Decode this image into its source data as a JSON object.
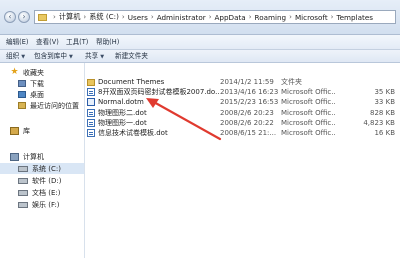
{
  "address": {
    "crumbs": [
      "计算机",
      "系统 (C:)",
      "Users",
      "Administrator",
      "AppData",
      "Roaming",
      "Microsoft",
      "Templates"
    ],
    "separator": "›"
  },
  "menu": {
    "items": [
      "组织",
      "包含到库中",
      "共享",
      "新建文件夹"
    ]
  },
  "toolbar": {
    "items": [
      "编辑(E)",
      "查看(V)",
      "工具(T)",
      "帮助(H)"
    ]
  },
  "sidebar": {
    "favorites_label": "收藏夹",
    "favorites": [
      "下载",
      "桌面",
      "最近访问的位置"
    ],
    "library_label": "库",
    "computer_label": "计算机",
    "drives": [
      "系统 (C:)",
      "软件 (D:)",
      "文档 (E:)",
      "娱乐 (F:)"
    ]
  },
  "files": [
    {
      "name": "Document Themes",
      "date": "2014/1/2 11:59",
      "type": "文件夹",
      "size": "",
      "icon": "folder-icon"
    },
    {
      "name": "8开双面双页码密封试卷模板2007.do...",
      "date": "2013/4/16 16:23",
      "type": "Microsoft Offic...",
      "size": "35 KB",
      "icon": "word-doc-icon"
    },
    {
      "name": "Normal.dotm",
      "date": "2015/2/23 16:53",
      "type": "Microsoft Offic...",
      "size": "33 KB",
      "icon": "word-template-icon"
    },
    {
      "name": "物理图形二.dot",
      "date": "2008/2/6 20:23",
      "type": "Microsoft Offic...",
      "size": "828 KB",
      "icon": "word-doc-icon"
    },
    {
      "name": "物理图形一.dot",
      "date": "2008/2/6 20:22",
      "type": "Microsoft Offic...",
      "size": "4,823 KB",
      "icon": "word-doc-icon"
    },
    {
      "name": "信息技术试卷模板.dot",
      "date": "2008/6/15 21:...",
      "type": "Microsoft Offic...",
      "size": "16 KB",
      "icon": "word-doc-icon"
    }
  ],
  "colors": {
    "annotation_arrow": "#e03a2f",
    "selection": "#d9e6f5"
  }
}
